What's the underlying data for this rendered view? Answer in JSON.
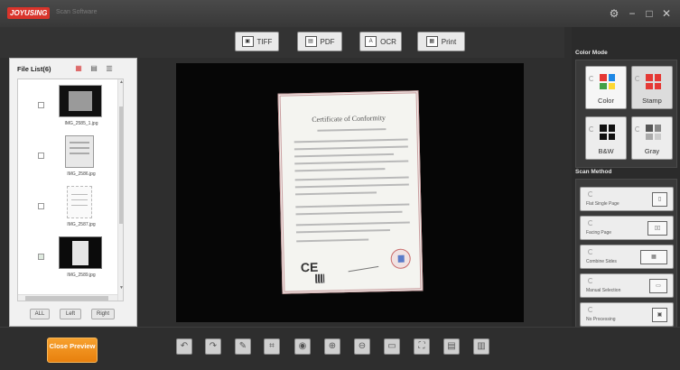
{
  "window": {
    "logo_text": "JOYUSING",
    "subtitle": "Scan Software",
    "controls": [
      "gear-icon",
      "minimize-icon",
      "maximize-icon",
      "close-icon"
    ]
  },
  "toolbar": {
    "buttons": [
      {
        "label": "TIFF",
        "icon": "tiff-icon",
        "glyph": "▣"
      },
      {
        "label": "PDF",
        "icon": "pdf-icon",
        "glyph": "▤"
      },
      {
        "label": "OCR",
        "icon": "ocr-icon",
        "glyph": "A"
      },
      {
        "label": "Print",
        "icon": "printer-icon",
        "glyph": "▦"
      }
    ]
  },
  "file_list": {
    "title": "File List(6)",
    "items": [
      {
        "name": "IMG_2585_1.jpg",
        "checked": false
      },
      {
        "name": "IMG_2586.jpg",
        "checked": false
      },
      {
        "name": "IMG_2587.jpg",
        "checked": false
      },
      {
        "name": "IMG_2589.jpg",
        "checked": true
      }
    ],
    "buttons": {
      "all": "ALL",
      "left": "Left",
      "right": "Right"
    }
  },
  "preview": {
    "doc_title": "Certificate of Conformity",
    "mark": "CE"
  },
  "color_mode": {
    "title": "Color Mode",
    "modes": [
      {
        "label": "Color",
        "colors": [
          "#e53935",
          "#1e88e5",
          "#43a047",
          "#fdd835"
        ]
      },
      {
        "label": "Stamp",
        "colors": [
          "#e53935",
          "#e53935",
          "#e53935",
          "#e53935"
        ]
      },
      {
        "label": "B&W",
        "colors": [
          "#111111",
          "#111111",
          "#111111",
          "#111111"
        ]
      },
      {
        "label": "Gray",
        "colors": [
          "#555555",
          "#888888",
          "#aaaaaa",
          "#cccccc"
        ]
      }
    ]
  },
  "scan_method": {
    "title": "Scan Method",
    "methods": [
      {
        "label": "Flat Single Page",
        "icon": "single-page-icon",
        "glyph": "▯"
      },
      {
        "label": "Facing Page",
        "icon": "facing-page-icon",
        "glyph": "▯▯"
      },
      {
        "label": "Combine Sides",
        "icon": "combine-sides-icon",
        "glyph": "▦"
      },
      {
        "label": "Manual Selection",
        "icon": "manual-selection-icon",
        "glyph": "▭"
      },
      {
        "label": "No Processing",
        "icon": "no-processing-icon",
        "glyph": "▣"
      }
    ]
  },
  "bottom": {
    "close_label": "Close Preview",
    "tools": [
      {
        "name": "undo-icon",
        "glyph": "↶"
      },
      {
        "name": "redo-icon",
        "glyph": "↷"
      },
      {
        "name": "edit-icon",
        "glyph": "✎"
      },
      {
        "name": "crop-icon",
        "glyph": "⌗"
      },
      {
        "name": "rotate-icon",
        "glyph": "◉"
      },
      {
        "name": "zoom-in-icon",
        "glyph": "⊕"
      },
      {
        "name": "zoom-out-icon",
        "glyph": "⊖"
      },
      {
        "name": "fit-page-icon",
        "glyph": "▭"
      },
      {
        "name": "fullscreen-icon",
        "glyph": "⛶"
      },
      {
        "name": "save-icon",
        "glyph": "▤"
      },
      {
        "name": "delete-icon",
        "glyph": "▥"
      }
    ]
  }
}
